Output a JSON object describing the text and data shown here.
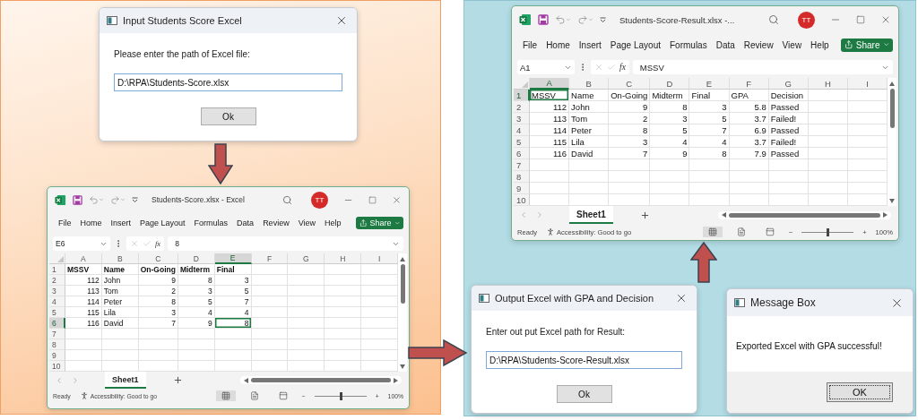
{
  "input_dialog": {
    "title": "Input Students Score Excel",
    "prompt": "Please enter the path of Excel file:",
    "value": "D:\\RPA\\Students-Score.xlsx",
    "button": "Ok"
  },
  "source_workbook": {
    "title": "Students-Score.xlsx  -  Excel",
    "avatar": "TT",
    "menu": [
      "File",
      "Home",
      "Insert",
      "Page Layout",
      "Formulas",
      "Data",
      "Review",
      "View",
      "Help"
    ],
    "share": "Share",
    "name_box": "E6",
    "fx": "fx",
    "formula": "8",
    "header_bold": true,
    "columns": [
      {
        "label": "A",
        "numeric": true,
        "selected": false
      },
      {
        "label": "B",
        "numeric": false,
        "selected": false
      },
      {
        "label": "C",
        "numeric": true,
        "selected": false
      },
      {
        "label": "D",
        "numeric": true,
        "selected": false
      },
      {
        "label": "E",
        "numeric": true,
        "selected": true
      },
      {
        "label": "F",
        "numeric": false,
        "selected": false
      },
      {
        "label": "G",
        "numeric": false,
        "selected": false
      },
      {
        "label": "H",
        "numeric": false,
        "selected": false
      },
      {
        "label": "I",
        "numeric": false,
        "selected": false
      }
    ],
    "rows": [
      {
        "number": "1",
        "kind": "header",
        "selected": false,
        "cells": [
          "MSSV",
          "Name",
          "On-Going",
          "Midterm",
          "Final"
        ]
      },
      {
        "number": "2",
        "kind": "data",
        "selected": false,
        "cells": [
          "112",
          "John",
          "9",
          "8",
          "3"
        ]
      },
      {
        "number": "3",
        "kind": "data",
        "selected": false,
        "cells": [
          "113",
          "Tom",
          "2",
          "3",
          "5"
        ]
      },
      {
        "number": "4",
        "kind": "data",
        "selected": false,
        "cells": [
          "114",
          "Peter",
          "8",
          "5",
          "7"
        ]
      },
      {
        "number": "5",
        "kind": "data",
        "selected": false,
        "cells": [
          "115",
          "Lila",
          "3",
          "4",
          "4"
        ]
      },
      {
        "number": "6",
        "kind": "data",
        "selected": true,
        "cells": [
          "116",
          "David",
          "7",
          "9",
          "8"
        ]
      },
      {
        "number": "7",
        "kind": "data",
        "selected": false,
        "cells": []
      },
      {
        "number": "8",
        "kind": "data",
        "selected": false,
        "cells": []
      },
      {
        "number": "9",
        "kind": "data",
        "selected": false,
        "cells": []
      },
      {
        "number": "10",
        "kind": "data",
        "selected": false,
        "cells": []
      }
    ],
    "sheet_tab": {
      "label": "Sheet1",
      "selected": true
    },
    "status": "Ready",
    "accessibility": "Accessibility: Good to go",
    "view_buttons": [
      {
        "kind": "normal",
        "selected": true
      },
      {
        "kind": "page_layout",
        "selected": false
      },
      {
        "kind": "page_break",
        "selected": false
      }
    ],
    "zoom_out": "−",
    "zoom_slider": {
      "level": 0.5
    },
    "zoom_in": "+",
    "zoom": "100%"
  },
  "output_dialog": {
    "title": "Output Excel with GPA and Decision",
    "prompt": "Enter out put Excel path for Result:",
    "value": "D:\\RPA\\Students-Score-Result.xlsx",
    "button": "Ok"
  },
  "result_workbook": {
    "title": "Students-Score-Result.xlsx  -...",
    "avatar": "TT",
    "menu": [
      "File",
      "Home",
      "Insert",
      "Page Layout",
      "Formulas",
      "Data",
      "Review",
      "View",
      "Help"
    ],
    "share": "Share",
    "name_box": "A1",
    "fx": "fx",
    "formula": "MSSV",
    "header_bold": false,
    "columns": [
      {
        "label": "A",
        "numeric": true,
        "selected": true
      },
      {
        "label": "B",
        "numeric": false,
        "selected": false
      },
      {
        "label": "C",
        "numeric": true,
        "selected": false
      },
      {
        "label": "D",
        "numeric": true,
        "selected": false
      },
      {
        "label": "E",
        "numeric": true,
        "selected": false
      },
      {
        "label": "F",
        "numeric": true,
        "selected": false
      },
      {
        "label": "G",
        "numeric": false,
        "selected": false
      },
      {
        "label": "H",
        "numeric": false,
        "selected": false
      },
      {
        "label": "I",
        "numeric": false,
        "selected": false
      }
    ],
    "rows": [
      {
        "number": "1",
        "kind": "header",
        "selected": true,
        "cells": [
          "MSSV",
          "Name",
          "On-Going",
          "Midterm",
          "Final",
          "GPA",
          "Decision"
        ]
      },
      {
        "number": "2",
        "kind": "data",
        "selected": false,
        "cells": [
          "112",
          "John",
          "9",
          "8",
          "3",
          "5.8",
          "Passed"
        ]
      },
      {
        "number": "3",
        "kind": "data",
        "selected": false,
        "cells": [
          "113",
          "Tom",
          "2",
          "3",
          "5",
          "3.7",
          "Failed!"
        ]
      },
      {
        "number": "4",
        "kind": "data",
        "selected": false,
        "cells": [
          "114",
          "Peter",
          "8",
          "5",
          "7",
          "6.9",
          "Passed"
        ]
      },
      {
        "number": "5",
        "kind": "data",
        "selected": false,
        "cells": [
          "115",
          "Lila",
          "3",
          "4",
          "4",
          "3.7",
          "Failed!"
        ]
      },
      {
        "number": "6",
        "kind": "data",
        "selected": false,
        "cells": [
          "116",
          "David",
          "7",
          "9",
          "8",
          "7.9",
          "Passed"
        ]
      },
      {
        "number": "7",
        "kind": "data",
        "selected": false,
        "cells": []
      },
      {
        "number": "8",
        "kind": "data",
        "selected": false,
        "cells": []
      },
      {
        "number": "9",
        "kind": "data",
        "selected": false,
        "cells": []
      },
      {
        "number": "10",
        "kind": "data",
        "selected": false,
        "cells": []
      }
    ],
    "sheet_tab": {
      "label": "Sheet1",
      "selected": true
    },
    "status": "Ready",
    "accessibility": "Accessibility: Good to go",
    "view_buttons": [
      {
        "kind": "normal",
        "selected": true
      },
      {
        "kind": "page_layout",
        "selected": false
      },
      {
        "kind": "page_break",
        "selected": false
      }
    ],
    "zoom_out": "−",
    "zoom_slider": {
      "level": 0.5
    },
    "zoom_in": "+",
    "zoom": "100%"
  },
  "message_box": {
    "title": "Message Box",
    "message": "Exported Excel with GPA successful!",
    "button": "OK"
  }
}
